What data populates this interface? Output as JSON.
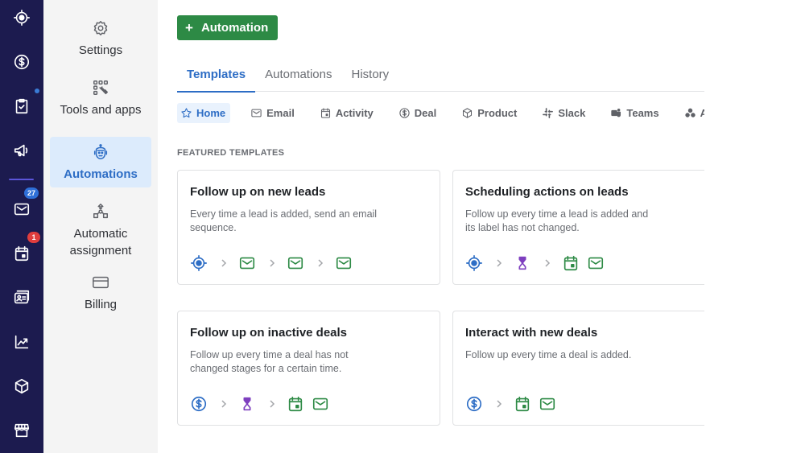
{
  "rail": {
    "items": [
      {
        "name": "leads",
        "icon": "target-icon"
      },
      {
        "name": "deals",
        "icon": "dollar-icon"
      },
      {
        "name": "projects",
        "icon": "clipboard-check-icon"
      },
      {
        "name": "campaigns",
        "icon": "megaphone-icon"
      },
      {
        "name": "mail",
        "icon": "mail-icon",
        "badge": "27"
      },
      {
        "name": "activities",
        "icon": "calendar-icon",
        "badge": "1"
      },
      {
        "name": "contacts",
        "icon": "contact-card-icon"
      },
      {
        "name": "insights",
        "icon": "chart-line-icon"
      },
      {
        "name": "products",
        "icon": "box-icon"
      },
      {
        "name": "marketplace",
        "icon": "store-icon"
      }
    ]
  },
  "sidebar": {
    "items": [
      {
        "label": "Settings",
        "icon": "gear-icon"
      },
      {
        "label": "Tools and apps",
        "icon": "tools-icon"
      },
      {
        "label": "Automations",
        "icon": "robot-icon",
        "active": true
      },
      {
        "label": "Automatic assignment",
        "icon": "assignment-icon"
      },
      {
        "label": "Billing",
        "icon": "credit-card-icon"
      }
    ]
  },
  "main": {
    "add_button": {
      "icon": "+",
      "label": "Automation"
    },
    "tabs": [
      {
        "label": "Templates",
        "active": true
      },
      {
        "label": "Automations"
      },
      {
        "label": "History"
      }
    ],
    "categories": [
      {
        "label": "Home",
        "icon": "star-icon",
        "active": true
      },
      {
        "label": "Email",
        "icon": "mail-icon"
      },
      {
        "label": "Activity",
        "icon": "calendar-icon"
      },
      {
        "label": "Deal",
        "icon": "dollar-icon"
      },
      {
        "label": "Product",
        "icon": "box-icon"
      },
      {
        "label": "Slack",
        "icon": "slack-icon"
      },
      {
        "label": "Teams",
        "icon": "teams-icon"
      },
      {
        "label": "Asana",
        "icon": "asana-icon"
      }
    ],
    "section_title": "FEATURED TEMPLATES",
    "cards": [
      {
        "title": "Follow up on new leads",
        "description": "Every time a lead is added, send an email sequence.",
        "flow": [
          "lead-target-icon",
          "chevron",
          "mail-icon",
          "chevron",
          "mail-icon",
          "chevron",
          "mail-icon"
        ]
      },
      {
        "title": "Scheduling actions on leads",
        "description": "Follow up every time a lead is added and its label has not changed.",
        "flow": [
          "lead-target-icon",
          "chevron",
          "hourglass-icon",
          "chevron",
          "calendar-icon",
          "mail-icon"
        ]
      },
      {
        "title": "Follow up on inactive deals",
        "description": "Follow up every time a deal has not changed stages for a certain time.",
        "flow": [
          "dollar-icon",
          "chevron",
          "hourglass-icon",
          "chevron",
          "calendar-icon",
          "mail-icon"
        ]
      },
      {
        "title": "Interact with new deals",
        "description": "Follow up every time a deal is added.",
        "flow": [
          "dollar-icon",
          "chevron",
          "calendar-icon",
          "mail-icon"
        ]
      }
    ]
  },
  "colors": {
    "rail_bg": "#1c1b4f",
    "accent_blue": "#2d6dc5",
    "primary_green": "#2d8a45",
    "purple": "#7e3fbf",
    "badge_blue": "#2e6fd8",
    "badge_red": "#e03d3d"
  }
}
